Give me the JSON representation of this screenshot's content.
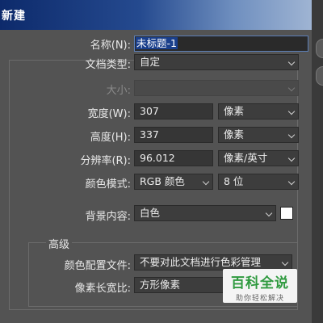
{
  "dialog": {
    "title": "新建",
    "name": {
      "label": "名称(N):",
      "value": "未标题-1"
    },
    "doc_type": {
      "label": "文档类型:",
      "value": "自定"
    },
    "size": {
      "label": "大小:",
      "value": ""
    },
    "width": {
      "label": "宽度(W):",
      "value": "307",
      "unit": "像素"
    },
    "height": {
      "label": "高度(H):",
      "value": "337",
      "unit": "像素"
    },
    "resolution": {
      "label": "分辨率(R):",
      "value": "96.012",
      "unit": "像素/英寸"
    },
    "color_mode": {
      "label": "颜色模式:",
      "value": "RGB 颜色",
      "depth": "8 位"
    },
    "background": {
      "label": "背景内容:",
      "value": "白色",
      "swatch_color": "#ffffff"
    },
    "advanced": {
      "title": "高级",
      "color_profile": {
        "label": "颜色配置文件:",
        "value": "不要对此文档进行色彩管理"
      },
      "pixel_aspect": {
        "label": "像素长宽比:",
        "value": "方形像素"
      }
    }
  },
  "watermark": {
    "main": "百科全说",
    "sub": "助你轻松解决"
  }
}
